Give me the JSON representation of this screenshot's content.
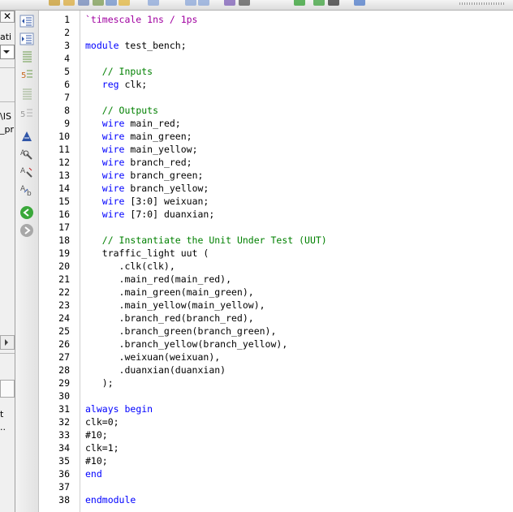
{
  "window": {
    "close_glyph": "✕",
    "left_panel_fragments": [
      "ati",
      "\\IS",
      "_pr",
      "t",
      ".."
    ]
  },
  "toolbar": {
    "buttons": [
      {
        "icon": "edit-icon",
        "color": "#c89a2a"
      },
      {
        "icon": "open-icon",
        "color": "#d9a93b"
      },
      {
        "icon": "save-icon",
        "color": "#6f86b8"
      },
      {
        "icon": "check-icon",
        "color": "#7a9a50"
      },
      {
        "icon": "view-icon",
        "color": "#6c8fc8"
      },
      {
        "icon": "highlight-icon",
        "color": "#e0b43a"
      },
      {
        "icon": "box-icon",
        "color": "#8aa6d8"
      },
      {
        "icon": "box-icon",
        "color": "#8aa6d8"
      },
      {
        "icon": "box-icon",
        "color": "#8aa6d8"
      },
      {
        "icon": "tool-icon",
        "color": "#7b5bb5"
      },
      {
        "icon": "wand-icon",
        "color": "#555555"
      },
      {
        "icon": "run-icon",
        "color": "#2e9e2e"
      },
      {
        "icon": "wave-icon",
        "color": "#3aa03a"
      },
      {
        "icon": "stop-icon",
        "color": "#333333"
      },
      {
        "icon": "help-icon",
        "color": "#4b78c8"
      }
    ]
  },
  "editor_tools": [
    {
      "icon": "indent-left-icon"
    },
    {
      "icon": "indent-right-icon"
    },
    {
      "icon": "list-icon"
    },
    {
      "icon": "numbered-list-icon"
    },
    {
      "icon": "list-alt-icon"
    },
    {
      "icon": "comment-icon"
    },
    {
      "icon": "insert-template-icon"
    },
    {
      "icon": "find-icon"
    },
    {
      "icon": "find-next-icon"
    },
    {
      "icon": "replace-icon"
    },
    {
      "icon": "go-back-icon"
    },
    {
      "icon": "go-forward-icon"
    }
  ],
  "colors": {
    "keyword": "#0000ff",
    "comment": "#008000",
    "directive": "#a000a0",
    "text": "#000000"
  },
  "editor": {
    "line_numbers": [
      "1",
      "2",
      "3",
      "4",
      "5",
      "6",
      "7",
      "8",
      "9",
      "10",
      "11",
      "12",
      "13",
      "14",
      "15",
      "16",
      "17",
      "18",
      "19",
      "20",
      "21",
      "22",
      "23",
      "24",
      "25",
      "26",
      "27",
      "28",
      "29",
      "30",
      "31",
      "32",
      "33",
      "34",
      "35",
      "36",
      "37",
      "38"
    ],
    "lines": [
      [
        {
          "t": "dir",
          "s": "`timescale 1ns / 1ps"
        }
      ],
      [],
      [
        {
          "t": "kw",
          "s": "module"
        },
        {
          "t": "tx",
          "s": " test_bench;"
        }
      ],
      [],
      [
        {
          "t": "tx",
          "s": "   "
        },
        {
          "t": "cm",
          "s": "// Inputs"
        }
      ],
      [
        {
          "t": "tx",
          "s": "   "
        },
        {
          "t": "kw",
          "s": "reg"
        },
        {
          "t": "tx",
          "s": " clk;"
        }
      ],
      [],
      [
        {
          "t": "tx",
          "s": "   "
        },
        {
          "t": "cm",
          "s": "// Outputs"
        }
      ],
      [
        {
          "t": "tx",
          "s": "   "
        },
        {
          "t": "kw",
          "s": "wire"
        },
        {
          "t": "tx",
          "s": " main_red;"
        }
      ],
      [
        {
          "t": "tx",
          "s": "   "
        },
        {
          "t": "kw",
          "s": "wire"
        },
        {
          "t": "tx",
          "s": " main_green;"
        }
      ],
      [
        {
          "t": "tx",
          "s": "   "
        },
        {
          "t": "kw",
          "s": "wire"
        },
        {
          "t": "tx",
          "s": " main_yellow;"
        }
      ],
      [
        {
          "t": "tx",
          "s": "   "
        },
        {
          "t": "kw",
          "s": "wire"
        },
        {
          "t": "tx",
          "s": " branch_red;"
        }
      ],
      [
        {
          "t": "tx",
          "s": "   "
        },
        {
          "t": "kw",
          "s": "wire"
        },
        {
          "t": "tx",
          "s": " branch_green;"
        }
      ],
      [
        {
          "t": "tx",
          "s": "   "
        },
        {
          "t": "kw",
          "s": "wire"
        },
        {
          "t": "tx",
          "s": " branch_yellow;"
        }
      ],
      [
        {
          "t": "tx",
          "s": "   "
        },
        {
          "t": "kw",
          "s": "wire"
        },
        {
          "t": "tx",
          "s": " [3:0] weixuan;"
        }
      ],
      [
        {
          "t": "tx",
          "s": "   "
        },
        {
          "t": "kw",
          "s": "wire"
        },
        {
          "t": "tx",
          "s": " [7:0] duanxian;"
        }
      ],
      [],
      [
        {
          "t": "tx",
          "s": "   "
        },
        {
          "t": "cm",
          "s": "// Instantiate the Unit Under Test (UUT)"
        }
      ],
      [
        {
          "t": "tx",
          "s": "   traffic_light uut ("
        }
      ],
      [
        {
          "t": "tx",
          "s": "      .clk(clk),"
        }
      ],
      [
        {
          "t": "tx",
          "s": "      .main_red(main_red),"
        }
      ],
      [
        {
          "t": "tx",
          "s": "      .main_green(main_green),"
        }
      ],
      [
        {
          "t": "tx",
          "s": "      .main_yellow(main_yellow),"
        }
      ],
      [
        {
          "t": "tx",
          "s": "      .branch_red(branch_red),"
        }
      ],
      [
        {
          "t": "tx",
          "s": "      .branch_green(branch_green),"
        }
      ],
      [
        {
          "t": "tx",
          "s": "      .branch_yellow(branch_yellow),"
        }
      ],
      [
        {
          "t": "tx",
          "s": "      .weixuan(weixuan),"
        }
      ],
      [
        {
          "t": "tx",
          "s": "      .duanxian(duanxian)"
        }
      ],
      [
        {
          "t": "tx",
          "s": "   );"
        }
      ],
      [],
      [
        {
          "t": "kw",
          "s": "always"
        },
        {
          "t": "tx",
          "s": " "
        },
        {
          "t": "kw",
          "s": "begin"
        }
      ],
      [
        {
          "t": "tx",
          "s": "clk=0;"
        }
      ],
      [
        {
          "t": "tx",
          "s": "#10;"
        }
      ],
      [
        {
          "t": "tx",
          "s": "clk=1;"
        }
      ],
      [
        {
          "t": "tx",
          "s": "#10;"
        }
      ],
      [
        {
          "t": "kw",
          "s": "end"
        }
      ],
      [],
      [
        {
          "t": "kw",
          "s": "endmodule"
        }
      ]
    ]
  }
}
